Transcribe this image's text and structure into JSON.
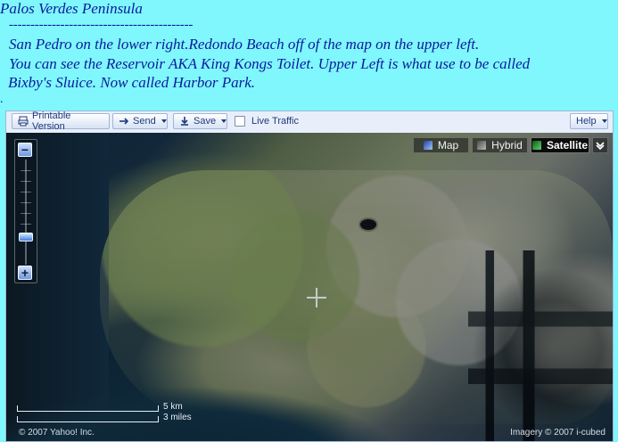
{
  "post": {
    "title": "Palos Verdes Peninsula",
    "rule": "-------------------------------------------",
    "lines": [
      "San Pedro on the lower right.Redondo Beach off of the map on the upper left.",
      "You can see the Reservoir AKA King Kongs Toilet. Upper Left is what use to be called",
      "Bixby's Sluice.  Now called Harbor Park."
    ],
    "trailing": "."
  },
  "map": {
    "toolbar": {
      "printable": "Printable Version",
      "send": "Send",
      "save": "Save",
      "live_traffic": "Live Traffic",
      "help": "Help"
    },
    "types": {
      "map": "Map",
      "hybrid": "Hybrid",
      "satellite": "Satellite",
      "active": "satellite"
    },
    "scale": {
      "km": "5 km",
      "miles": "3 miles"
    },
    "footer": {
      "copyright": "© 2007 Yahoo! Inc.",
      "imagery": "Imagery © 2007 i-cubed"
    },
    "zoom": {
      "minus": "−",
      "plus": "+"
    },
    "icons": {
      "print": "printer-icon",
      "send": "send-icon",
      "save": "save-icon",
      "more": "chevron-down-icon"
    }
  }
}
